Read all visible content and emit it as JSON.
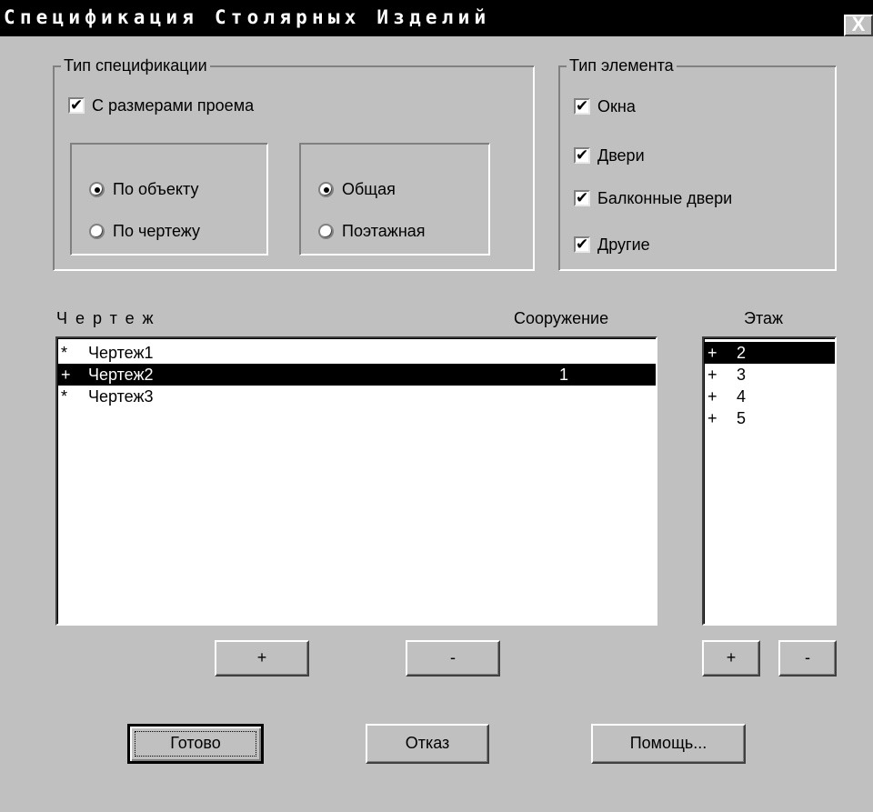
{
  "window": {
    "title": "Спецификация Столярных Изделий",
    "close_label": "X"
  },
  "spec_type": {
    "legend": "Тип спецификации",
    "with_opening_sizes": {
      "label": "С размерами проема",
      "checked": true
    },
    "scope": [
      {
        "label": "По объекту",
        "selected": true
      },
      {
        "label": "По чертежу",
        "selected": false
      }
    ],
    "mode": [
      {
        "label": "Общая",
        "selected": true
      },
      {
        "label": "Поэтажная",
        "selected": false
      }
    ]
  },
  "element_type": {
    "legend": "Тип элемента",
    "items": [
      {
        "label": "Окна",
        "checked": true
      },
      {
        "label": "Двери",
        "checked": true
      },
      {
        "label": "Балконные двери",
        "checked": true
      },
      {
        "label": "Другие",
        "checked": true
      }
    ]
  },
  "drawings": {
    "header_drawing": "Чертеж",
    "header_structure": "Сооружение",
    "rows": [
      {
        "mark": "*",
        "name": "Чертеж1",
        "structure": "",
        "selected": false
      },
      {
        "mark": "+",
        "name": "Чертеж2",
        "structure": "1",
        "selected": true
      },
      {
        "mark": "*",
        "name": "Чертеж3",
        "structure": "",
        "selected": false
      }
    ],
    "add_label": "+",
    "remove_label": "-"
  },
  "floors": {
    "header": "Этаж",
    "rows": [
      {
        "mark": "+",
        "value": "2",
        "selected": true
      },
      {
        "mark": "+",
        "value": "3",
        "selected": false
      },
      {
        "mark": "+",
        "value": "4",
        "selected": false
      },
      {
        "mark": "+",
        "value": "5",
        "selected": false
      }
    ],
    "add_label": "+",
    "remove_label": "-"
  },
  "actions": {
    "ok_label": "Готово",
    "cancel_label": "Отказ",
    "help_label": "Помощь..."
  },
  "check_glyph": "✔"
}
